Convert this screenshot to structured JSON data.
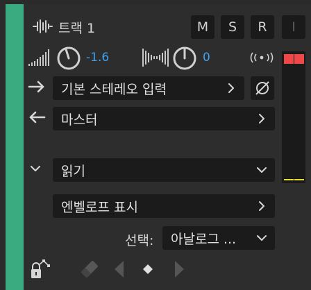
{
  "track": {
    "name": "트랙 1",
    "mute_label": "M",
    "solo_label": "S",
    "record_label": "R",
    "input_monitor_label": "I"
  },
  "volume": {
    "value": "-1.6"
  },
  "pan": {
    "value": "0"
  },
  "input": {
    "label": "기본 스테레오 입력"
  },
  "output": {
    "label": "마스터"
  },
  "automation": {
    "mode_label": "읽기",
    "envelope_label": "엔벨로프 표시",
    "select_label": "선택:",
    "select_value": "아날로그 ..."
  },
  "colors": {
    "track_color": "#3aab80",
    "value_blue": "#3fa2f0",
    "meter_peak": "#f04848",
    "meter_floor": "#e8dc2a"
  }
}
